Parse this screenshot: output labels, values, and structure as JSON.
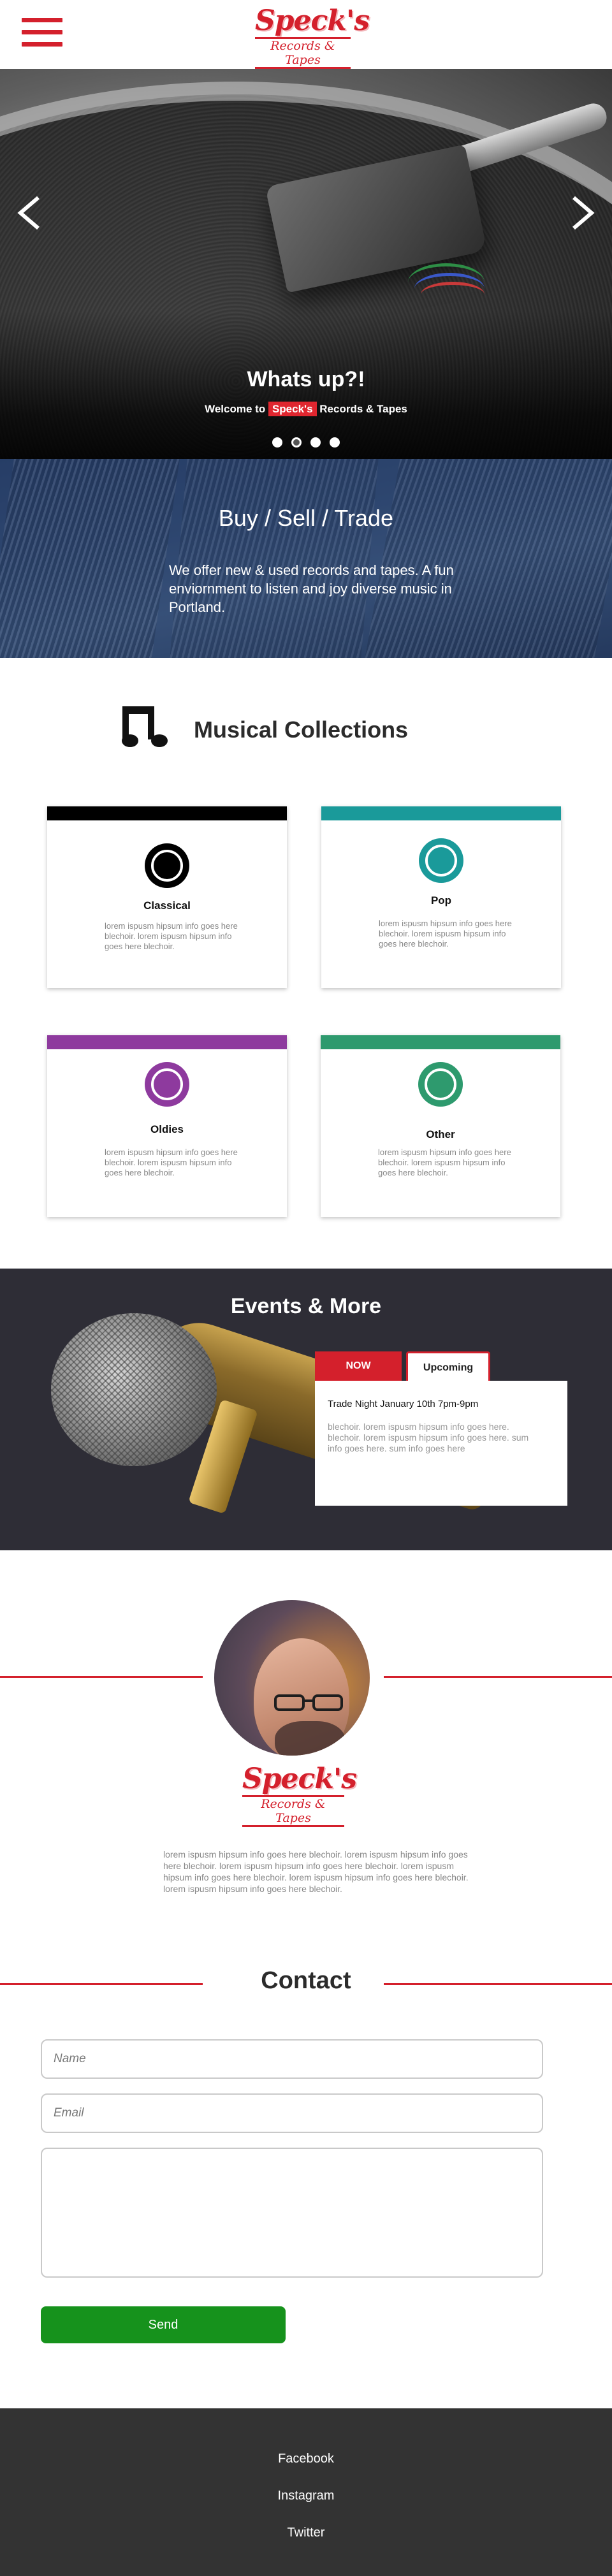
{
  "header": {
    "menu_icon": "hamburger-menu-icon",
    "logo_main": "Speck's",
    "logo_sub": "Records & Tapes",
    "accent": "#d4202c"
  },
  "hero": {
    "title": "Whats up?!",
    "subtitle_before": "Welcome to ",
    "subtitle_brand": "Speck's",
    "subtitle_after": " Records & Tapes",
    "prev_icon": "chevron-left-icon",
    "next_icon": "chevron-right-icon",
    "slide_count": 4,
    "active_slide": 2
  },
  "buysell": {
    "title": "Buy / Sell / Trade",
    "text": "We offer new & used records and tapes. A fun enviornment to listen and joy diverse music in Portland."
  },
  "collections": {
    "title": "Musical Collections",
    "icon": "music-note-icon",
    "items": [
      {
        "name": "Classical",
        "color": "#000000",
        "text": "lorem ispusm hipsum info goes here blechoir. lorem ispusm hipsum info goes here blechoir."
      },
      {
        "name": "Pop",
        "color": "#1a9a9a",
        "text": "lorem ispusm hipsum info goes here blechoir. lorem ispusm hipsum info goes here blechoir."
      },
      {
        "name": "Oldies",
        "color": "#8e3a9e",
        "text": "lorem ispusm hipsum info goes here blechoir. lorem ispusm hipsum info goes here blechoir."
      },
      {
        "name": "Other",
        "color": "#2e9a6e",
        "text": "lorem ispusm hipsum info goes here blechoir. lorem ispusm hipsum info goes here blechoir."
      }
    ]
  },
  "events": {
    "title": "Events & More",
    "tab_now": "NOW",
    "tab_upcoming": "Upcoming",
    "event_title": "Trade Night January 10th 7pm-9pm",
    "event_text": "blechoir. lorem ispusm hipsum info goes here. blechoir. lorem ispusm hipsum info goes here. sum info goes here. sum info goes here"
  },
  "about": {
    "logo_main": "Speck's",
    "logo_sub": "Records & Tapes",
    "text": "lorem ispusm hipsum info goes here blechoir. lorem ispusm hipsum info goes here blechoir. lorem ispusm hipsum info goes here blechoir. lorem ispusm hipsum info goes here blechoir. lorem ispusm hipsum info goes here blechoir. lorem ispusm hipsum info goes here blechoir."
  },
  "contact": {
    "title": "Contact",
    "name_placeholder": "Name",
    "email_placeholder": "Email",
    "message_placeholder": "",
    "send_label": "Send",
    "send_color": "#16921c"
  },
  "footer": {
    "links": [
      "Facebook",
      "Instagram",
      "Twitter"
    ],
    "background": "#333333"
  }
}
